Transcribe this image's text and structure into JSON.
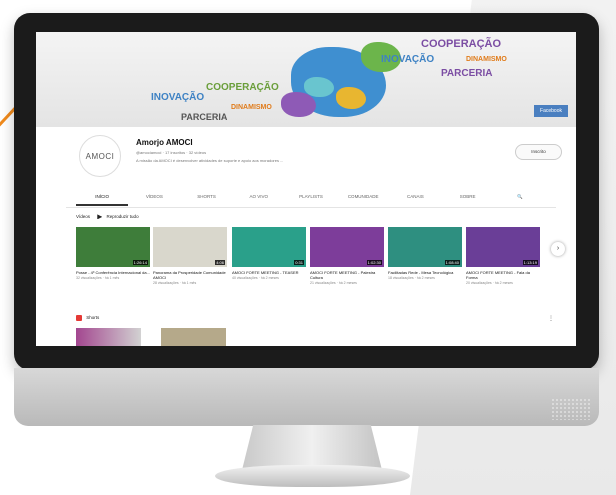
{
  "banner": {
    "words": [
      "COOPERAÇÃO",
      "INOVAÇÃO",
      "DINAMISMO",
      "PARCERIA",
      "COOPERAÇÃO",
      "INOVAÇÃO",
      "DINAMISMO",
      "PARCERIA"
    ],
    "tv_badge": "Facebook"
  },
  "channel": {
    "avatar_text": "AMOCI",
    "name": "Amorjo AMOCI",
    "meta": "@amociamoci · 17 inscritos · 32 vídeos",
    "description": "A missão da AMOCI é desenvolver atividades de suporte e apoio aos moradores ...",
    "subscribe_label": "Inscrito"
  },
  "tabs": [
    "INÍCIO",
    "VÍDEOS",
    "SHORTS",
    "AO VIVO",
    "PLAYLISTS",
    "COMUNIDADE",
    "CANAIS",
    "SOBRE",
    "🔍"
  ],
  "section": {
    "label": "Vídeos",
    "play_all": "Reproduzir tudo"
  },
  "videos": [
    {
      "title": "Posse - 4º Conferência Internacional da...",
      "meta": "32 visualizações · há 1 mês",
      "duration": "1:26:14",
      "color": "#3e7d3a"
    },
    {
      "title": "Panorama da Prosperidade Comunidade AMOCI",
      "meta": "28 visualizações · há 1 mês",
      "duration": "4:06",
      "color": "#d9d7cc"
    },
    {
      "title": "AMOCI FORTE MEETING - TEASER",
      "meta": "40 visualizações · há 2 meses",
      "duration": "0:31",
      "color": "#2aa08a"
    },
    {
      "title": "AMOCI FORTE MEETING - Palestra Cultura",
      "meta": "21 visualizações · há 2 meses",
      "duration": "1:02:30",
      "color": "#7d3d9a"
    },
    {
      "title": "Facilitadas Rede - Mesa Tecnológica",
      "meta": "18 visualizações · há 2 meses",
      "duration": "1:08:40",
      "color": "#2e8f80"
    },
    {
      "title": "AMOCI FORTE MEETING - Fala da Forma",
      "meta": "20 visualizações · há 2 meses",
      "duration": "1:13:19",
      "color": "#6a3e97"
    }
  ],
  "mixes": {
    "label": "Shorts"
  }
}
